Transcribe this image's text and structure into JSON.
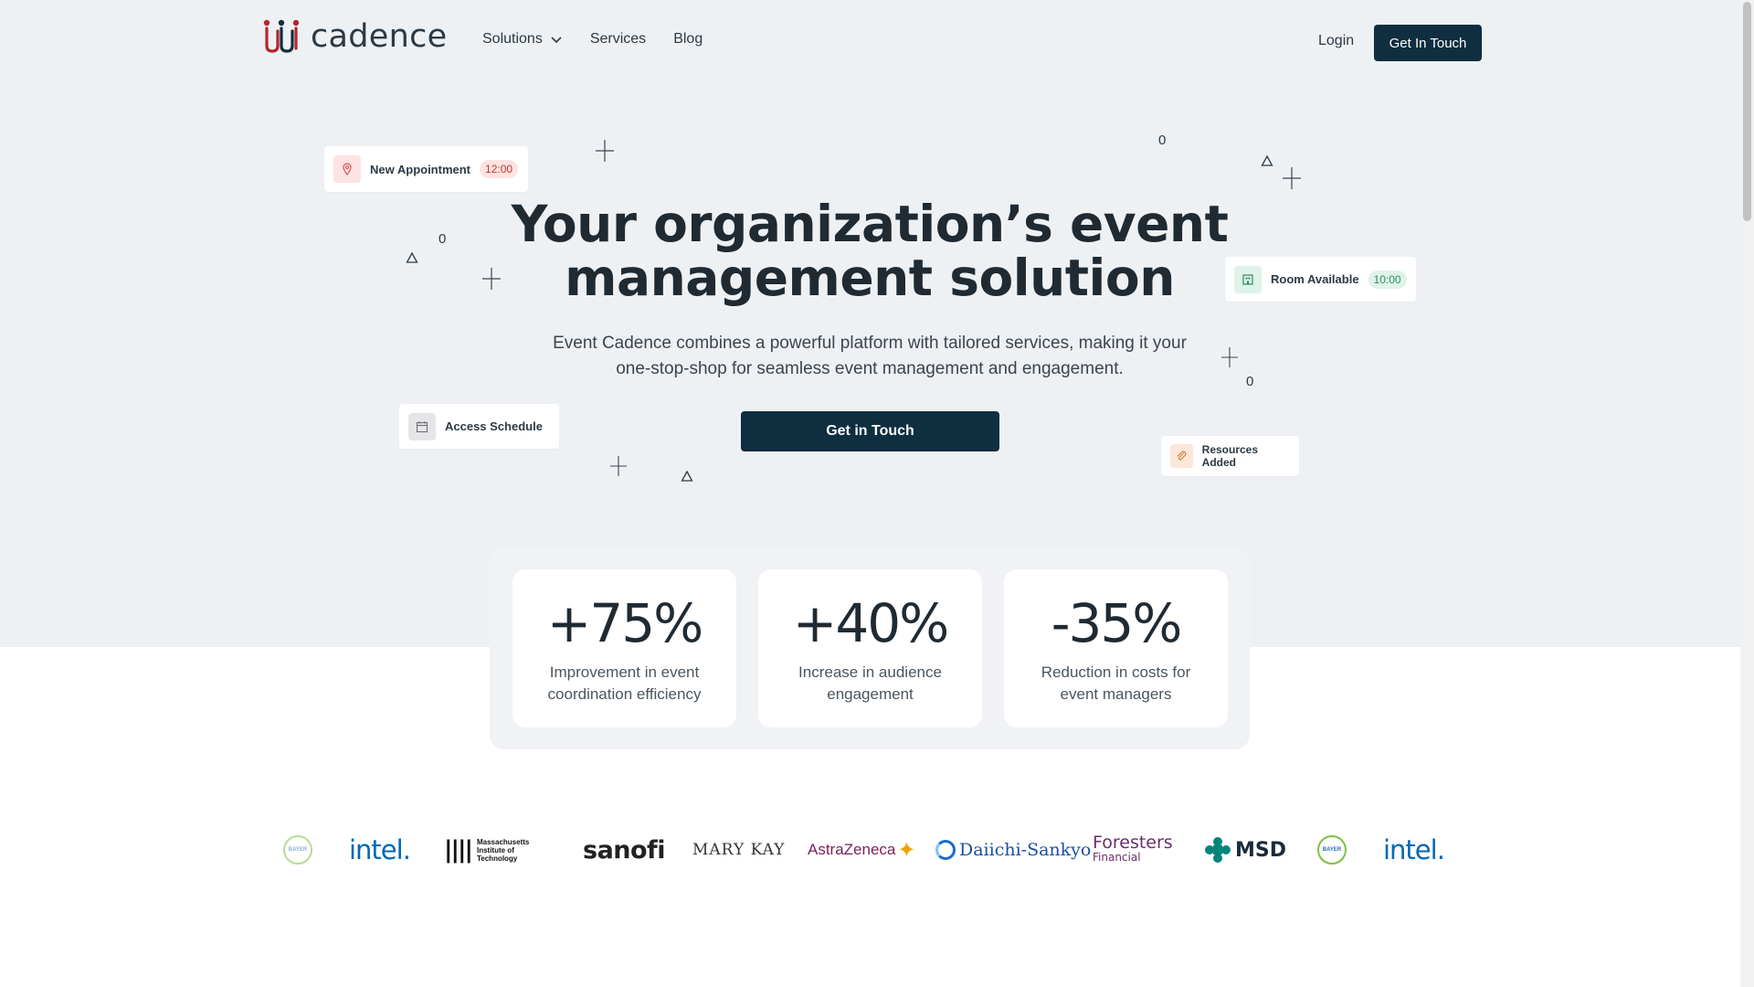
{
  "brand": {
    "name": "cadence",
    "colors": {
      "primary": "#0f2e40",
      "hero_bg": "#eef1f4"
    }
  },
  "nav": {
    "items": [
      {
        "label": "Solutions",
        "has_dropdown": true
      },
      {
        "label": "Services"
      },
      {
        "label": "Blog"
      }
    ],
    "login_label": "Login",
    "cta_label": "Get In Touch"
  },
  "hero": {
    "title_line1": "Your organization’s event",
    "title_line2": "management solution",
    "subtitle_line1": "Event Cadence combines a powerful platform with tailored services, making it your",
    "subtitle_line2": "one-stop-shop for seamless event management and engagement.",
    "cta_label": "Get in Touch"
  },
  "floating_cards": {
    "new_appointment": {
      "label": "New Appointment",
      "time": "12:00",
      "icon": "pin-icon"
    },
    "room_available": {
      "label": "Room Available",
      "time": "10:00",
      "icon": "building-icon"
    },
    "access_schedule": {
      "label": "Access Schedule",
      "icon": "calendar-icon"
    },
    "resources_added": {
      "label": "Resources Added",
      "icon": "paperclip-icon"
    }
  },
  "decorations": {
    "zero": "0"
  },
  "stats": [
    {
      "value": "+75%",
      "label_line1": "Improvement in event",
      "label_line2": "coordination efficiency"
    },
    {
      "value": "+40%",
      "label_line1": "Increase in audience",
      "label_line2": "engagement"
    },
    {
      "value": "-35%",
      "label_line1": "Reduction in costs for",
      "label_line2": "event managers"
    }
  ],
  "logos": {
    "bayer": "BAYER",
    "intel": "intel.",
    "mit_line1": "Massachusetts",
    "mit_line2": "Institute of",
    "mit_line3": "Technology",
    "sanofi": "sanofi",
    "marykay": "MARY KAY",
    "astrazeneca": "AstraZeneca",
    "daiichi": "Daiichi-Sankyo",
    "foresters": "Foresters",
    "foresters_sub": "Financial",
    "msd": "MSD"
  }
}
